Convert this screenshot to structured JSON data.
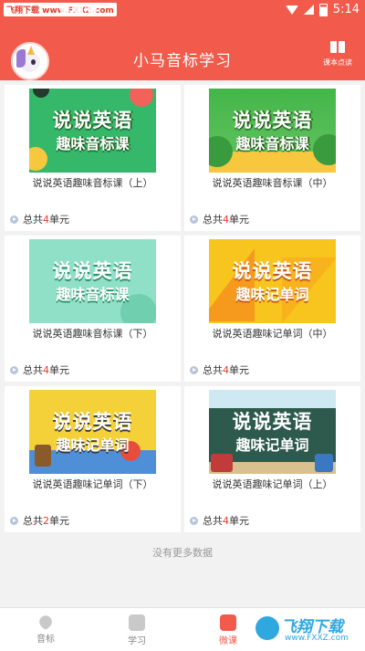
{
  "status_bar": {
    "watermark_text": "飞翔下载 www.FXXZ.com",
    "time": "5:14"
  },
  "header": {
    "title": "小马音标学习",
    "right_label": "课本点读"
  },
  "courses": [
    {
      "title": "说说英语趣味音标课（上）",
      "units_prefix": "总共",
      "units_count": "4",
      "units_suffix": "单元",
      "thumb_line1": "说说英语",
      "thumb_line2": "趣味音标课"
    },
    {
      "title": "说说英语趣味音标课（中）",
      "units_prefix": "总共",
      "units_count": "4",
      "units_suffix": "单元",
      "thumb_line1": "说说英语",
      "thumb_line2": "趣味音标课"
    },
    {
      "title": "说说英语趣味音标课（下）",
      "units_prefix": "总共",
      "units_count": "4",
      "units_suffix": "单元",
      "thumb_line1": "说说英语",
      "thumb_line2": "趣味音标课"
    },
    {
      "title": "说说英语趣味记单词（中）",
      "units_prefix": "总共",
      "units_count": "4",
      "units_suffix": "单元",
      "thumb_line1": "说说英语",
      "thumb_line2": "趣味记单词"
    },
    {
      "title": "说说英语趣味记单词（下）",
      "units_prefix": "总共",
      "units_count": "2",
      "units_suffix": "单元",
      "thumb_line1": "说说英语",
      "thumb_line2": "趣味记单词"
    },
    {
      "title": "说说英语趣味记单词（上）",
      "units_prefix": "总共",
      "units_count": "4",
      "units_suffix": "单元",
      "thumb_line1": "说说英语",
      "thumb_line2": "趣味记单词"
    }
  ],
  "no_more": "没有更多数据",
  "tabs": [
    {
      "label": "音标",
      "icon": "heart-a-icon",
      "active": false
    },
    {
      "label": "学习",
      "icon": "book-icon",
      "active": false
    },
    {
      "label": "微课",
      "icon": "bookmark-icon",
      "active": true
    }
  ],
  "watermark": {
    "line1": "飞翔下载",
    "line2": "www.FXXZ.com"
  },
  "colors": {
    "brand": "#f25b4b",
    "count_red": "#e53a2a"
  }
}
